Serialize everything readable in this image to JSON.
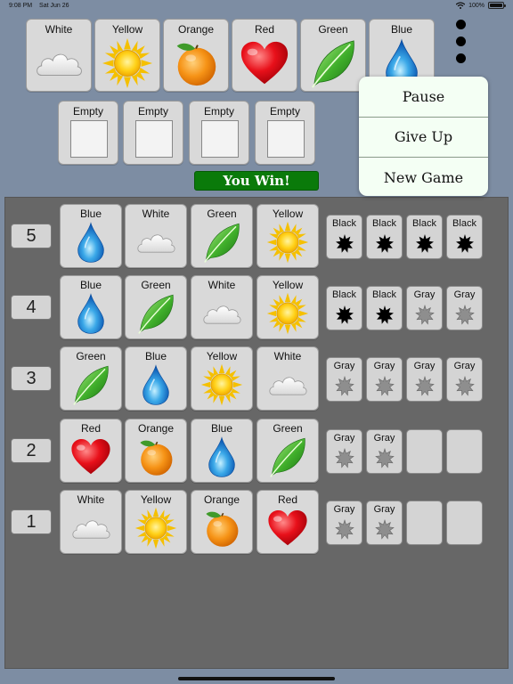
{
  "status_bar": {
    "time": "9:08 PM",
    "date": "Sat Jun 26",
    "battery": "100%",
    "battery_level": 1.0
  },
  "palette": [
    {
      "label": "White",
      "icon": "cloud-icon"
    },
    {
      "label": "Yellow",
      "icon": "sun-icon"
    },
    {
      "label": "Orange",
      "icon": "orange-icon"
    },
    {
      "label": "Red",
      "icon": "heart-icon"
    },
    {
      "label": "Green",
      "icon": "leaf-icon"
    },
    {
      "label": "Blue",
      "icon": "drop-icon"
    }
  ],
  "current_guess": [
    "Empty",
    "Empty",
    "Empty",
    "Empty"
  ],
  "result_banner": "You Win!",
  "menu": {
    "items": [
      "Pause",
      "Give Up",
      "New Game"
    ]
  },
  "board": {
    "rows": [
      {
        "number": "5",
        "guess": [
          "Blue",
          "White",
          "Green",
          "Yellow"
        ],
        "pegs": [
          "Black",
          "Black",
          "Black",
          "Black"
        ]
      },
      {
        "number": "4",
        "guess": [
          "Blue",
          "Green",
          "White",
          "Yellow"
        ],
        "pegs": [
          "Black",
          "Black",
          "Gray",
          "Gray"
        ]
      },
      {
        "number": "3",
        "guess": [
          "Green",
          "Blue",
          "Yellow",
          "White"
        ],
        "pegs": [
          "Gray",
          "Gray",
          "Gray",
          "Gray"
        ]
      },
      {
        "number": "2",
        "guess": [
          "Red",
          "Orange",
          "Blue",
          "Green"
        ],
        "pegs": [
          "Gray",
          "Gray",
          "",
          ""
        ]
      },
      {
        "number": "1",
        "guess": [
          "White",
          "Yellow",
          "Orange",
          "Red"
        ],
        "pegs": [
          "Gray",
          "Gray",
          "",
          ""
        ]
      }
    ]
  },
  "colors": {
    "peg_black": "#000000",
    "peg_gray": "#8e8e8e",
    "banner": "#0a7a0a",
    "board_bg": "#676767",
    "page_bg": "#7d8da3"
  }
}
